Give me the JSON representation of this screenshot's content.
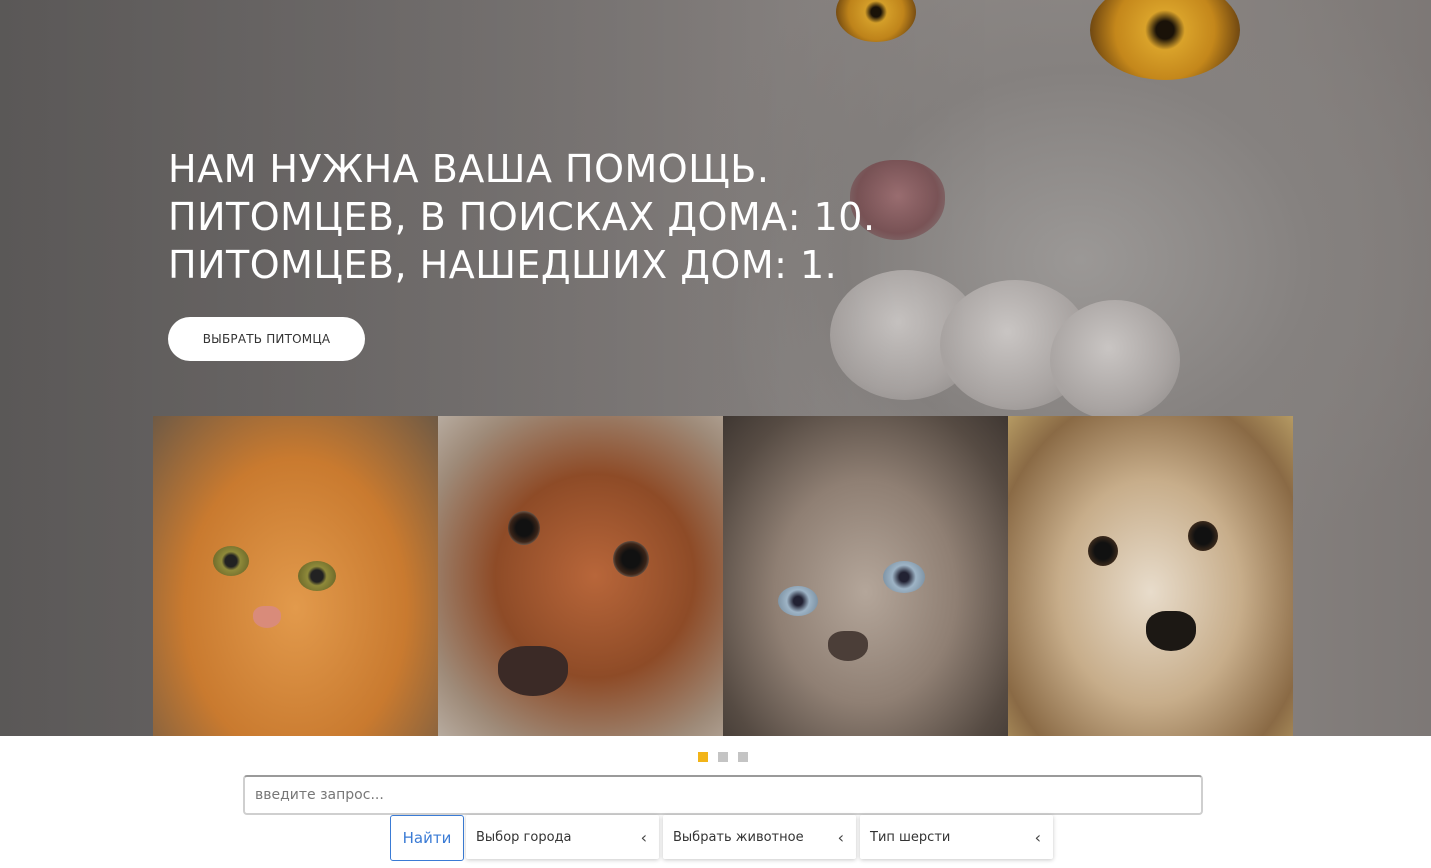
{
  "hero": {
    "lines": [
      "НАМ НУЖНА ВАША ПОМОЩЬ.",
      "ПИТОМЦЕВ, В ПОИСКАХ ДОМА: 10.",
      "ПИТОМЦЕВ, НАШЕДШИХ ДОМ: 1."
    ],
    "cta_label": "ВЫБРАТЬ ПИТОМЦА"
  },
  "carousel": {
    "slides": [
      "orange-cat",
      "dachshund",
      "persian-cat",
      "puppy"
    ],
    "dots": 3,
    "active_dot": 1,
    "active_color": "#f2b418"
  },
  "search": {
    "placeholder": "введите запрос...",
    "value": ""
  },
  "filters": {
    "find_label": "Найти",
    "city_label": "Выбор города",
    "animal_label": "Выбрать животное",
    "fur_label": "Тип шерсти"
  },
  "colors": {
    "accent": "#3a7bd5",
    "dot_active": "#f2b418",
    "dot_inactive": "#c4c4c4"
  }
}
